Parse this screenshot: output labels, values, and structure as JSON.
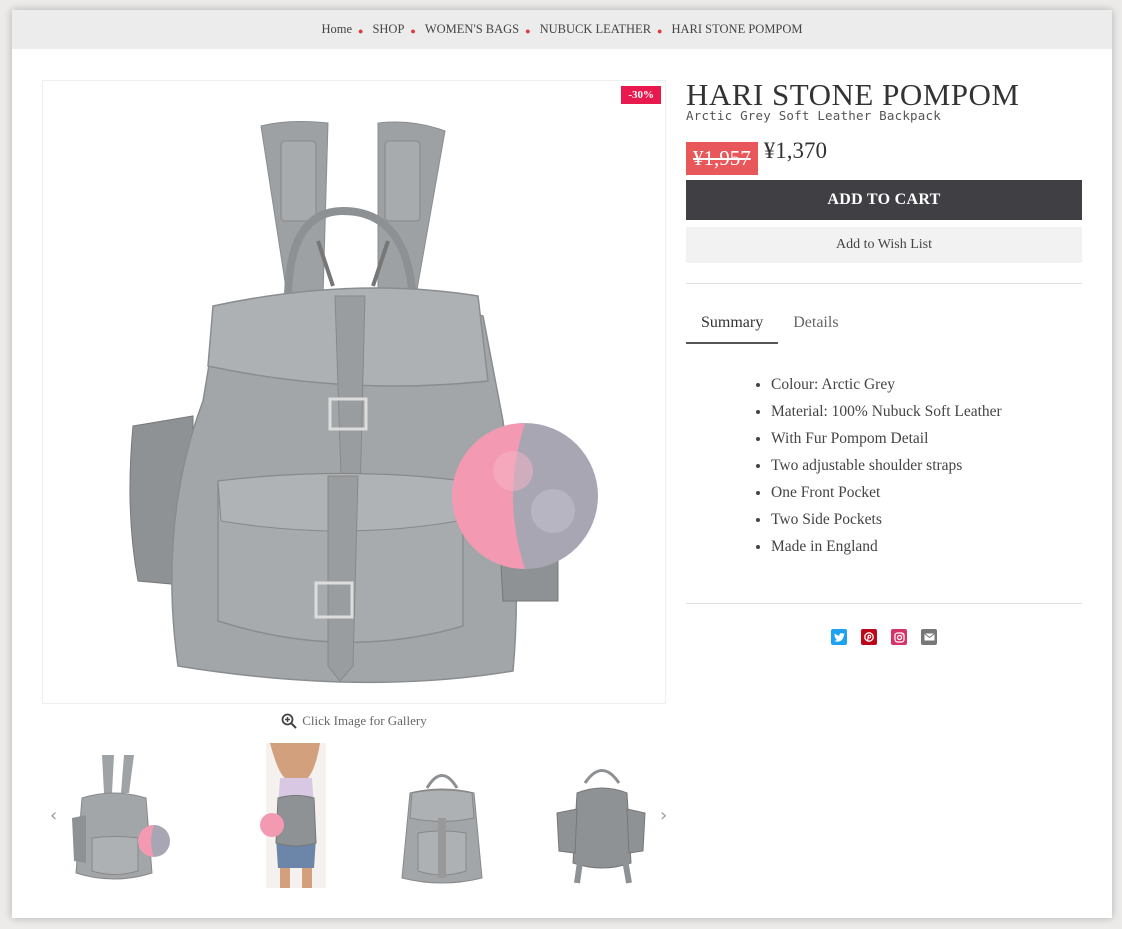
{
  "breadcrumb": {
    "items": [
      "Home",
      "SHOP",
      "WOMEN'S BAGS",
      "NUBUCK LEATHER",
      "HARI STONE POMPOM"
    ]
  },
  "product": {
    "title": "HARI STONE POMPOM",
    "subtitle": "Arctic Grey Soft Leather Backpack",
    "discount_badge": "-30%",
    "old_price": "¥1,957",
    "new_price": "¥1,370"
  },
  "actions": {
    "add_to_cart": "ADD TO CART",
    "wish_list": "Add to Wish List"
  },
  "gallery": {
    "hint": "Click Image for Gallery"
  },
  "tabs": [
    {
      "label": "Summary",
      "active": true
    },
    {
      "label": "Details",
      "active": false
    }
  ],
  "features": [
    "Colour: Arctic Grey",
    "Material: 100% Nubuck Soft Leather",
    "With Fur Pompom Detail",
    "Two adjustable shoulder straps",
    "One Front Pocket",
    "Two Side Pockets",
    "Made in England"
  ],
  "share": [
    {
      "icon": "twitter-icon",
      "color": "#1da1f2"
    },
    {
      "icon": "pinterest-icon",
      "color": "#bd081c"
    },
    {
      "icon": "instagram-icon",
      "color": "#c13584"
    },
    {
      "icon": "email-icon",
      "color": "#777777"
    }
  ],
  "colors": {
    "accent_red": "#e8194e",
    "price_red": "#e8585a",
    "button_dark": "#3f3f44",
    "bag_grey": "#a3a6a8"
  }
}
